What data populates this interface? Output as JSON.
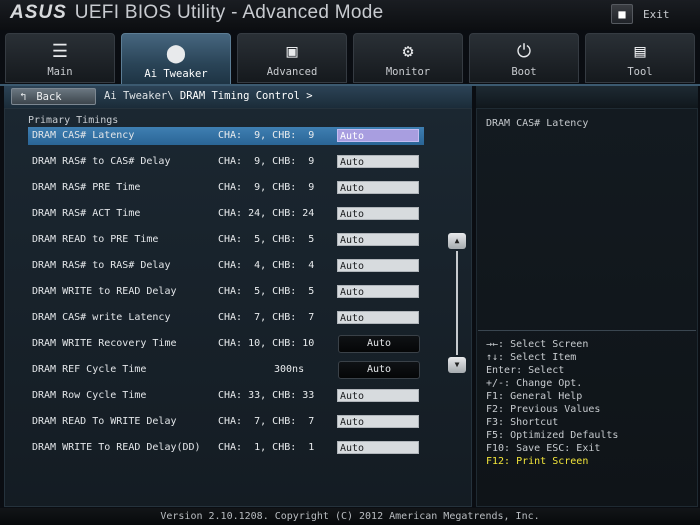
{
  "window": {
    "brand": "ASUS",
    "title": "UEFI BIOS Utility - Advanced Mode",
    "exit_label": "Exit"
  },
  "tabs": [
    {
      "label": "Main",
      "icon": "main-list-icon",
      "active": false
    },
    {
      "label": "Ai Tweaker",
      "icon": "ai-tweaker-icon",
      "active": true
    },
    {
      "label": "Advanced",
      "icon": "advanced-icon",
      "active": false
    },
    {
      "label": "Monitor",
      "icon": "monitor-icon",
      "active": false
    },
    {
      "label": "Boot",
      "icon": "power-icon",
      "active": false
    },
    {
      "label": "Tool",
      "icon": "tool-icon",
      "active": false
    }
  ],
  "nav": {
    "back_label": "Back",
    "breadcrumb_parent": "Ai Tweaker\\",
    "breadcrumb_current": "DRAM Timing Control >"
  },
  "section": {
    "title": "Primary Timings"
  },
  "rows": [
    {
      "name": "DRAM CAS# Latency",
      "value": "CHA:  9, CHB:  9",
      "setting": "Auto",
      "type": "field",
      "selected": true
    },
    {
      "name": "DRAM RAS# to CAS# Delay",
      "value": "CHA:  9, CHB:  9",
      "setting": "Auto",
      "type": "field"
    },
    {
      "name": "DRAM RAS# PRE Time",
      "value": "CHA:  9, CHB:  9",
      "setting": "Auto",
      "type": "field"
    },
    {
      "name": "DRAM RAS# ACT Time",
      "value": "CHA: 24, CHB: 24",
      "setting": "Auto",
      "type": "field"
    },
    {
      "name": "DRAM READ to PRE Time",
      "value": "CHA:  5, CHB:  5",
      "setting": "Auto",
      "type": "field"
    },
    {
      "name": "DRAM RAS# to RAS# Delay",
      "value": "CHA:  4, CHB:  4",
      "setting": "Auto",
      "type": "field"
    },
    {
      "name": "DRAM WRITE to READ Delay",
      "value": "CHA:  5, CHB:  5",
      "setting": "Auto",
      "type": "field"
    },
    {
      "name": "DRAM CAS# write Latency",
      "value": "CHA:  7, CHB:  7",
      "setting": "Auto",
      "type": "field"
    },
    {
      "name": "DRAM WRITE Recovery Time",
      "value": "CHA: 10, CHB: 10",
      "setting": "Auto",
      "type": "dropdown"
    },
    {
      "name": "DRAM REF Cycle Time",
      "value": "300ns",
      "setting": "Auto",
      "type": "dropdown"
    },
    {
      "name": "DRAM Row Cycle Time",
      "value": "CHA: 33, CHB: 33",
      "setting": "Auto",
      "type": "field"
    },
    {
      "name": "DRAM READ To WRITE Delay",
      "value": "CHA:  7, CHB:  7",
      "setting": "Auto",
      "type": "field"
    },
    {
      "name": "DRAM WRITE To READ Delay(DD)",
      "value": "CHA:  1, CHB:  1",
      "setting": "Auto",
      "type": "field"
    }
  ],
  "help": {
    "description": "DRAM CAS# Latency",
    "keys": [
      "→←: Select Screen",
      "↑↓: Select Item",
      "Enter: Select",
      "+/-: Change Opt.",
      "F1: General Help",
      "F2: Previous Values",
      "F3: Shortcut",
      "F5: Optimized Defaults",
      "F10: Save  ESC: Exit"
    ],
    "highlight_key": "F12: Print Screen"
  },
  "footer": {
    "text": "Version 2.10.1208. Copyright (C) 2012 American Megatrends, Inc."
  }
}
